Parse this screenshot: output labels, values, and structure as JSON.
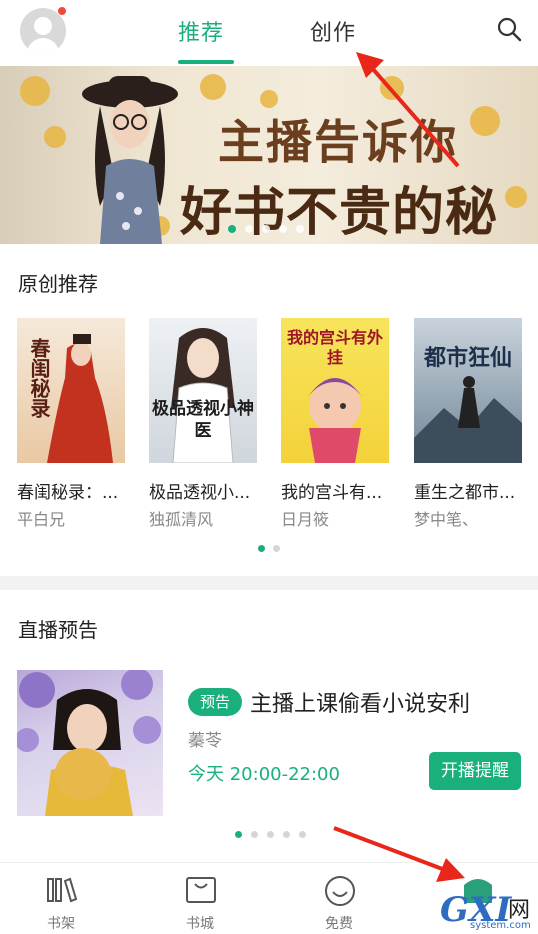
{
  "header": {
    "tabs": [
      {
        "label": "推荐",
        "active": true
      },
      {
        "label": "创作",
        "active": false
      }
    ],
    "search_icon": "search-icon",
    "avatar_icon": "avatar-icon",
    "accent_color": "#19b07c"
  },
  "banner": {
    "line1": "主播告诉你",
    "line2": "好书不贵的秘密",
    "page_count": 5,
    "active_page": 1
  },
  "original": {
    "title": "原创推荐",
    "books": [
      {
        "title": "春闺秘录：...",
        "author": "平白兄",
        "cover_text": "春闺秘录"
      },
      {
        "title": "极品透视小...",
        "author": "独孤清风",
        "cover_text": "极品透视小神医"
      },
      {
        "title": "我的宫斗有...",
        "author": "日月筱",
        "cover_text": "我的宫斗有外挂"
      },
      {
        "title": "重生之都市...",
        "author": "梦中笔、",
        "cover_text": "都市狂仙"
      }
    ],
    "page_count": 2,
    "active_page": 1
  },
  "live": {
    "title": "直播预告",
    "badge": "预告",
    "stream_title": "主播上课偷看小说安利",
    "host": "蓁苓",
    "time": "今天 20:00-22:00",
    "remind_label": "开播提醒",
    "page_count": 5,
    "active_page": 1
  },
  "bottom_nav": [
    {
      "label": "书架",
      "icon": "bookshelf-icon"
    },
    {
      "label": "书城",
      "icon": "bookstore-icon"
    },
    {
      "label": "免费",
      "icon": "free-icon"
    },
    {
      "label": "",
      "icon": "create-icon"
    }
  ],
  "watermark": {
    "big": "GXI",
    "net": "网",
    "sub": "system.com"
  }
}
